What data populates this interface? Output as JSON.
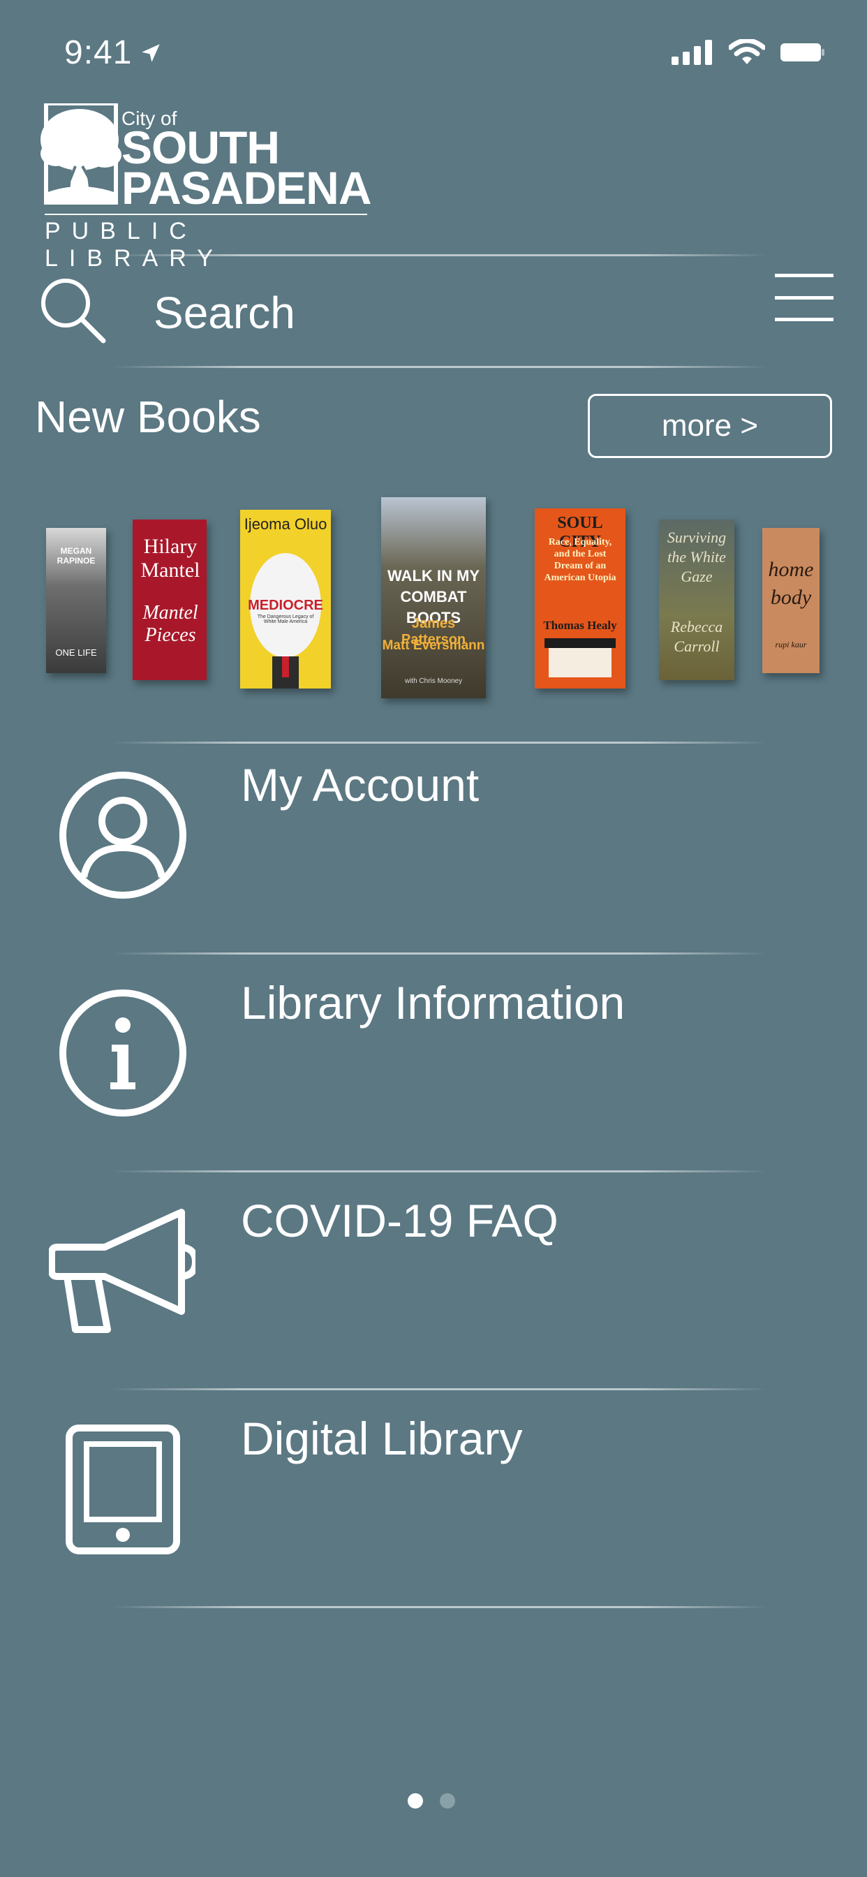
{
  "status_bar": {
    "time": "9:41",
    "location_icon": "location-arrow-icon",
    "signal_icon": "cellular-signal-icon",
    "wifi_icon": "wifi-icon",
    "battery_icon": "battery-icon"
  },
  "logo": {
    "line1": "City of",
    "line2": "SOUTH",
    "line3": "PASADENA",
    "line4": "PUBLIC LIBRARY",
    "icon": "oak-tree-icon"
  },
  "search": {
    "placeholder": "Search",
    "icon": "search-icon",
    "menu_icon": "hamburger-menu-icon"
  },
  "new_books": {
    "title": "New Books",
    "more_label": "more >",
    "books": [
      {
        "top": "MEGAN RAPINOE",
        "bottom": "ONE LIFE",
        "bg": "#7d7d7d"
      },
      {
        "top": "Hilary Mantel",
        "bottom": "Mantel Pieces",
        "bg": "#b31c2b"
      },
      {
        "top": "Ijeoma Oluo",
        "bottom": "MEDIOCRE",
        "sub": "The Dangerous Legacy of White Male America",
        "bg": "#f3d12a"
      },
      {
        "top": "WALK IN MY COMBAT BOOTS",
        "bottom": "James Patterson",
        "sub": "Matt Eversmann",
        "extra": "with Chris Mooney",
        "bg": "#4d4636"
      },
      {
        "top": "SOUL CITY",
        "bottom": "Race, Equality, and the Lost Dream of an American Utopia",
        "sub": "Thomas Healy",
        "bg": "#e55a17"
      },
      {
        "top": "Surviving the White Gaze",
        "bottom": "Rebecca Carroll",
        "bg": "#8a8a62"
      },
      {
        "top": "home body",
        "bottom": "rupi kaur",
        "bg": "#c98a5f"
      }
    ]
  },
  "menu": [
    {
      "label": "My Account",
      "icon": "user-account-icon"
    },
    {
      "label": "Library Information",
      "icon": "info-icon"
    },
    {
      "label": "COVID-19 FAQ",
      "icon": "megaphone-icon"
    },
    {
      "label": "Digital Library",
      "icon": "tablet-icon"
    }
  ],
  "pager": {
    "pages": 2,
    "active": 1
  }
}
